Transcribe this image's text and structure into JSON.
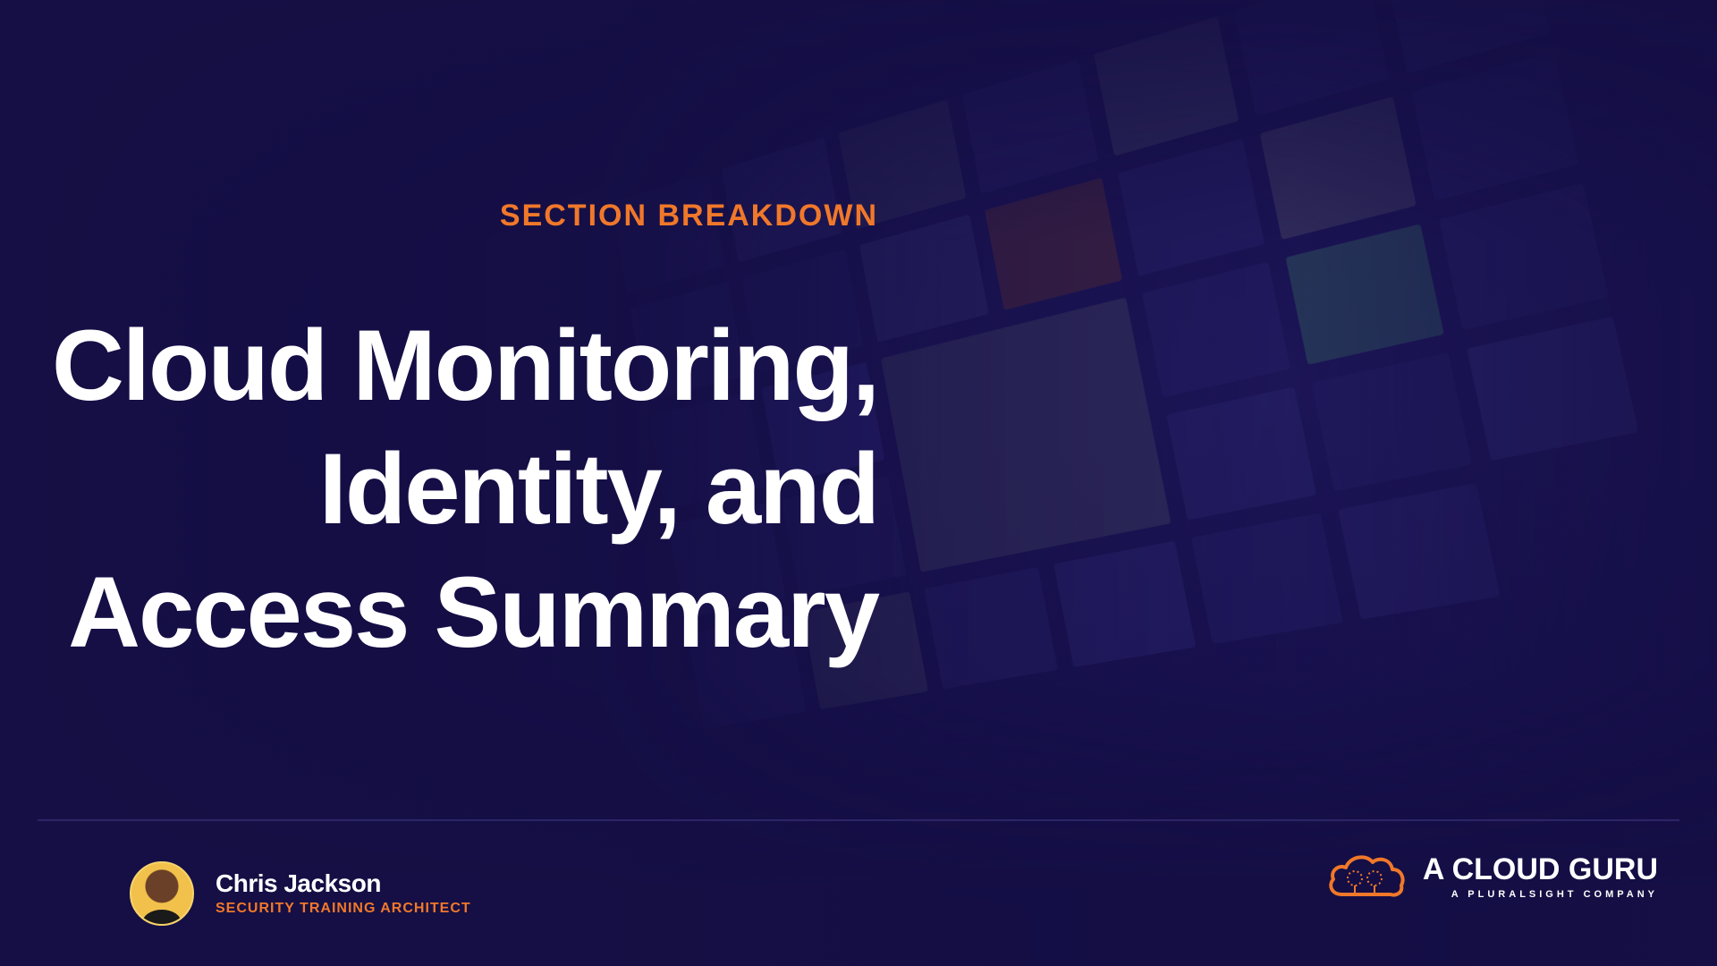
{
  "slide": {
    "eyebrow": "SECTION BREAKDOWN",
    "title_lines": [
      "Cloud Monitoring,",
      "Identity, and",
      "Access Summary"
    ]
  },
  "presenter": {
    "name": "Chris Jackson",
    "role": "SECURITY TRAINING ARCHITECT"
  },
  "brand": {
    "name": "A CLOUD GURU",
    "tagline": "A PLURALSIGHT COMPANY",
    "logo_icon": "cloud-icon"
  },
  "colors": {
    "background": "#150f45",
    "accent": "#f0782a",
    "text": "#ffffff"
  }
}
